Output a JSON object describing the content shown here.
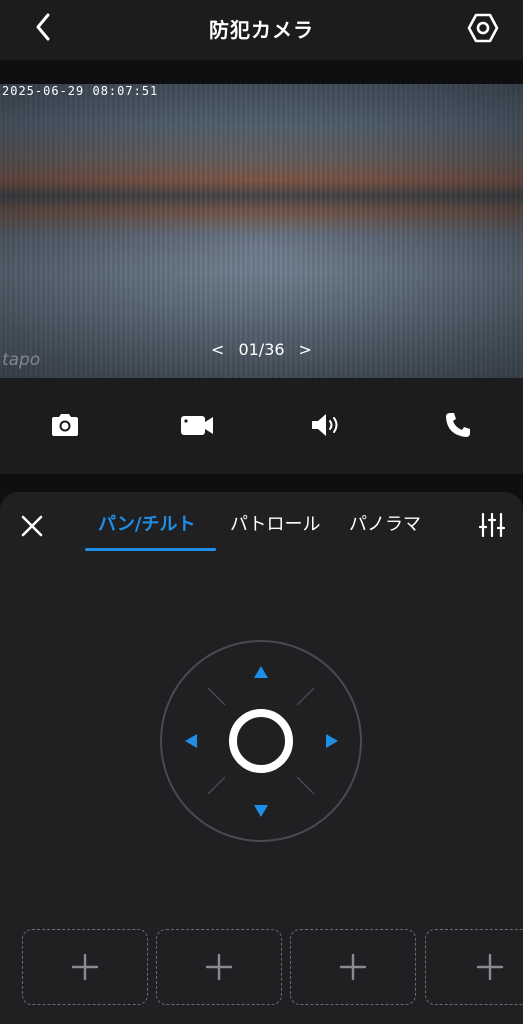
{
  "header": {
    "title": "防犯カメラ",
    "back_icon": "chevron-left-icon",
    "settings_icon": "gear-hexagon-icon"
  },
  "video": {
    "timestamp": "2025-06-29 08:07:51",
    "watermark": "tapo",
    "pager": {
      "prev": "<",
      "current": "01/36",
      "next": ">"
    }
  },
  "controls": {
    "items": [
      {
        "name": "screenshot",
        "icon": "camera-icon"
      },
      {
        "name": "record",
        "icon": "video-camera-icon"
      },
      {
        "name": "speaker",
        "icon": "speaker-icon"
      },
      {
        "name": "talk",
        "icon": "phone-icon"
      }
    ]
  },
  "panel": {
    "tabs": [
      {
        "label": "パン/チルト",
        "active": true
      },
      {
        "label": "パトロール",
        "active": false
      },
      {
        "label": "パノラマ",
        "active": false
      }
    ],
    "close_icon": "close-icon",
    "filter_icon": "sliders-icon"
  },
  "ptz": {
    "directions": [
      "up",
      "down",
      "left",
      "right"
    ],
    "accent": "#1e8fe6"
  },
  "presets": {
    "items": [
      {
        "icon": "plus-icon"
      },
      {
        "icon": "plus-icon"
      },
      {
        "icon": "plus-icon"
      },
      {
        "icon": "plus-icon"
      }
    ]
  },
  "colors": {
    "accent": "#1e8fe6",
    "background": "#0f0f11",
    "panel": "#202023"
  }
}
